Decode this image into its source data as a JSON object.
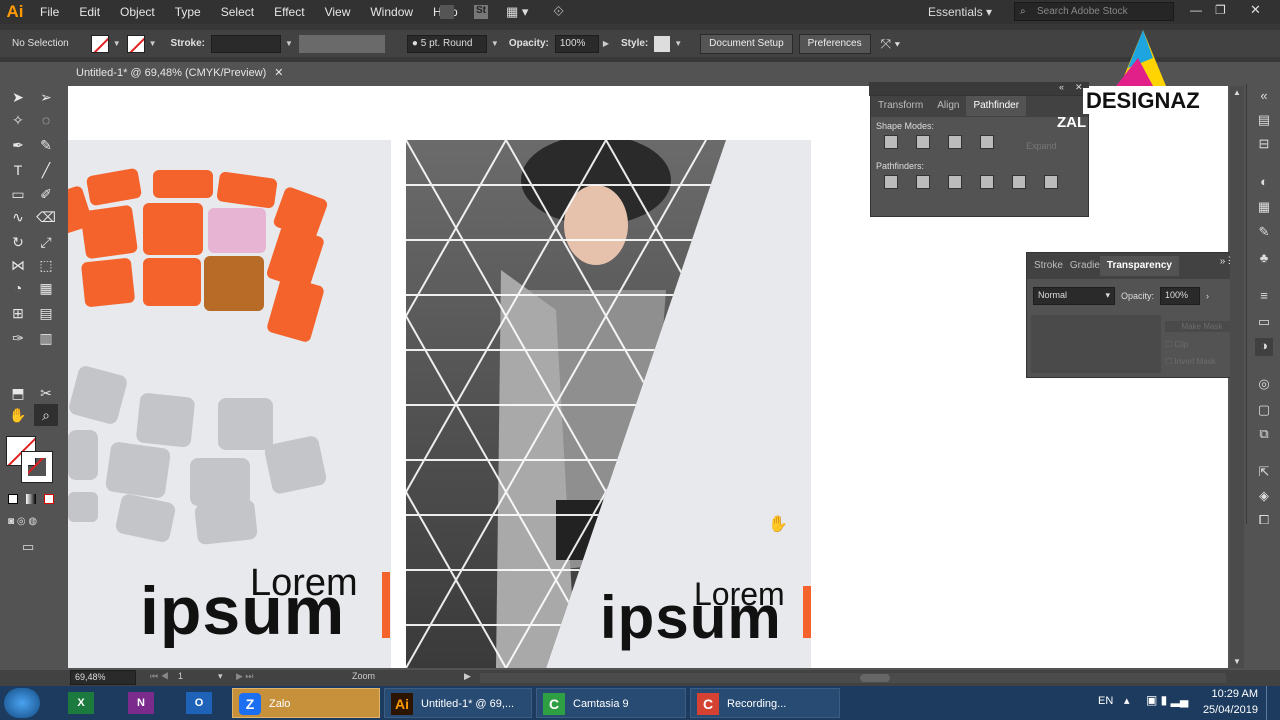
{
  "app": {
    "logo": "Ai",
    "menus": [
      "File",
      "Edit",
      "Object",
      "Type",
      "Select",
      "Effect",
      "View",
      "Window",
      "Help"
    ],
    "workspace": "Essentials",
    "stock_placeholder": "Search Adobe Stock"
  },
  "control": {
    "selection": "No Selection",
    "stroke_label": "Stroke:",
    "brush": "5 pt. Round",
    "opacity_label": "Opacity:",
    "opacity_value": "100%",
    "style_label": "Style:",
    "doc_setup": "Document Setup",
    "preferences": "Preferences"
  },
  "document": {
    "tab_title": "Untitled-1* @ 69,48% (CMYK/Preview)"
  },
  "artboards": [
    {
      "small": "Lorem",
      "big": "ipsum"
    },
    {
      "small": "Lorem",
      "big": "ipsum"
    }
  ],
  "pathfinder": {
    "tabs": [
      "Transform",
      "Align",
      "Pathfinder"
    ],
    "shape_modes": "Shape Modes:",
    "pathfinders": "Pathfinders:",
    "expand": "Expand"
  },
  "transparency": {
    "tabs": [
      "Stroke",
      "Gradie",
      "Transparency"
    ],
    "mode": "Normal",
    "opacity_label": "Opacity:",
    "opacity_value": "100%",
    "make_mask": "Make Mask",
    "clip": "Clip",
    "invert": "Invert Mask"
  },
  "watermark": {
    "brand": "DESIGNAZ",
    "sub": "ZAL"
  },
  "status": {
    "zoom": "69,48%",
    "page": "1",
    "mode": "Zoom"
  },
  "taskbar": {
    "apps": [
      "Zalo",
      "Untitled-1* @ 69,...",
      "Camtasia 9",
      "Recording..."
    ],
    "lang": "EN",
    "time": "10:29 AM",
    "date": "25/04/2019"
  },
  "colors": {
    "accent": "#ff6a2b",
    "ai_orange": "#ff9a00"
  }
}
